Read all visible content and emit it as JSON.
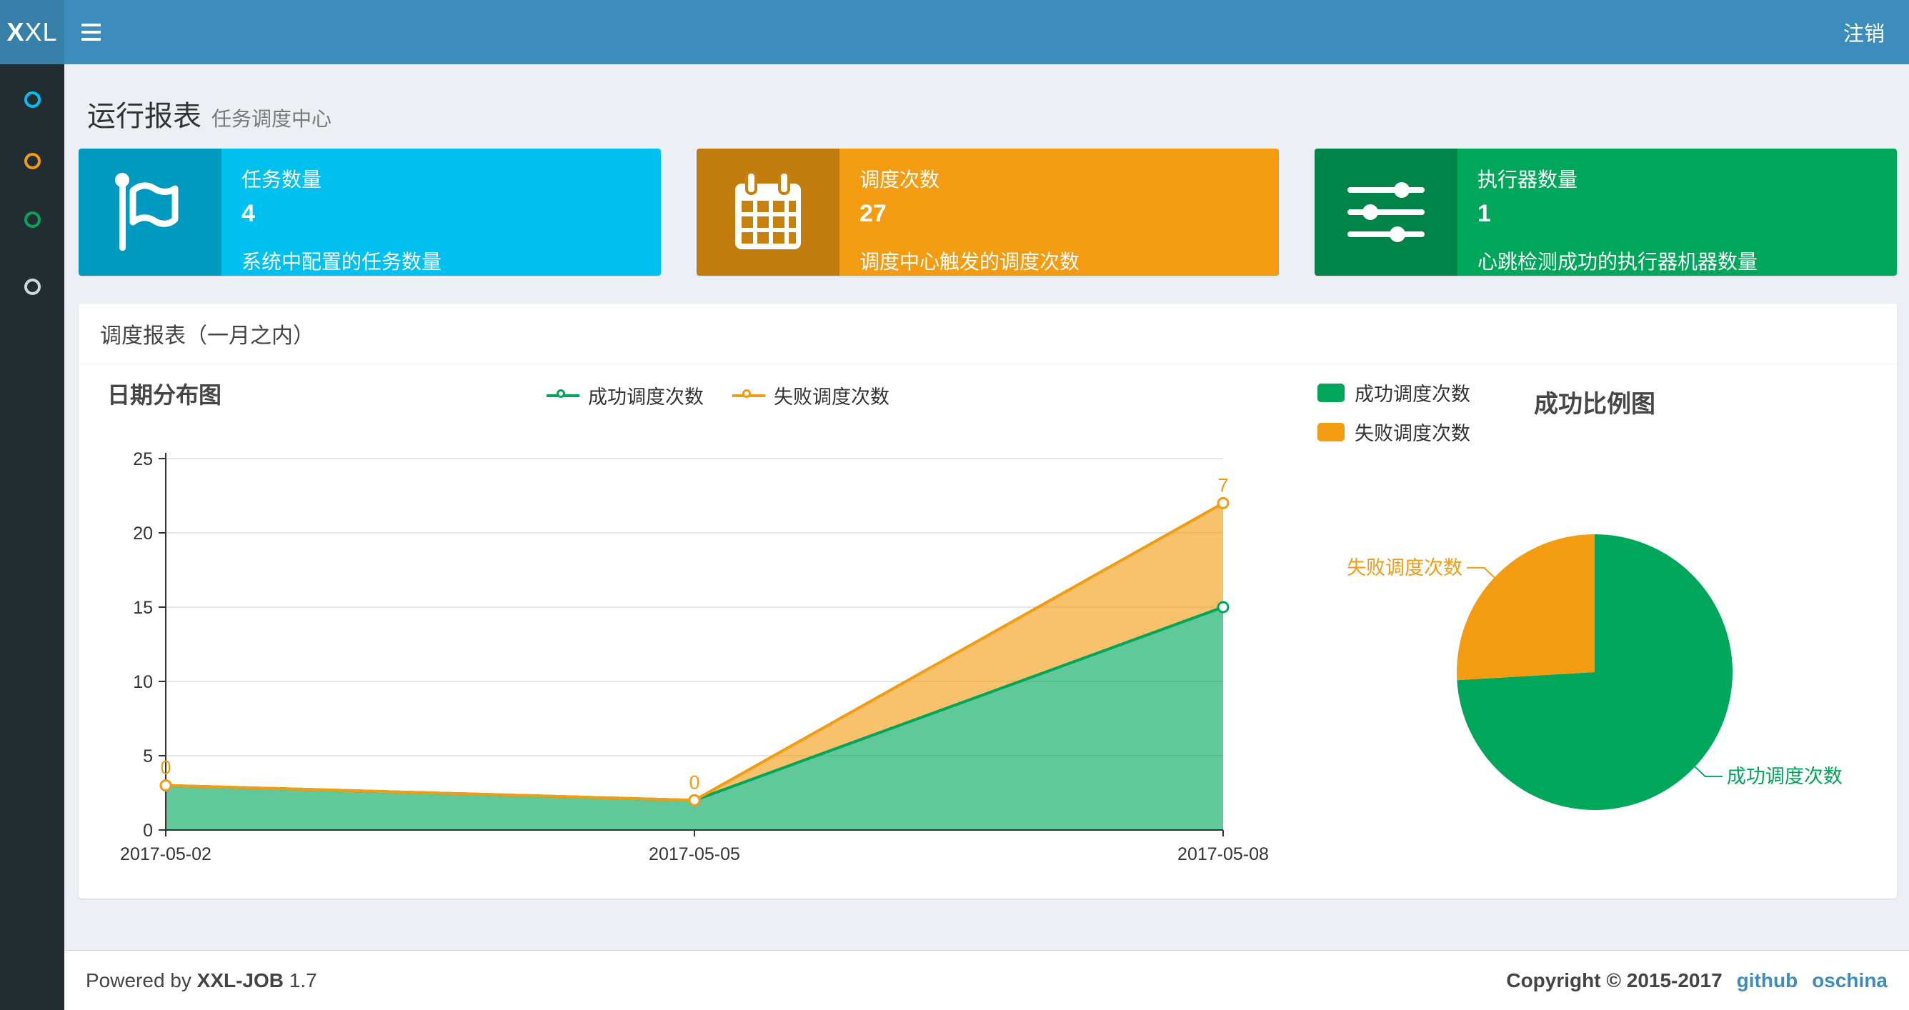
{
  "theme": {
    "navbar_bg": "#3c8dbc",
    "logo_bg": "#367fa9",
    "sidebar_bg": "#222d32",
    "page_bg": "#ecf0f5",
    "link_color": "#3c8dbc"
  },
  "navbar": {
    "logo": "XXL",
    "logout_label": "注销"
  },
  "sidebar": {
    "items": [
      {
        "icon": "circle-outline-icon",
        "color": "#00c0ef"
      },
      {
        "icon": "circle-outline-icon",
        "color": "#f39c12"
      },
      {
        "icon": "circle-outline-icon",
        "color": "#00a65a"
      },
      {
        "icon": "circle-outline-icon",
        "color": "#d2d6de"
      }
    ]
  },
  "page_header": {
    "title": "运行报表",
    "subtitle": "任务调度中心"
  },
  "info_boxes": [
    {
      "title": "任务数量",
      "value": "4",
      "description": "系统中配置的任务数量",
      "color": "#00c0ef",
      "icon": "flag-icon"
    },
    {
      "title": "调度次数",
      "value": "27",
      "description": "调度中心触发的调度次数",
      "color": "#f39c12",
      "icon": "calendar-icon"
    },
    {
      "title": "执行器数量",
      "value": "1",
      "description": "心跳检测成功的执行器机器数量",
      "color": "#00a65a",
      "icon": "sliders-icon"
    }
  ],
  "panel": {
    "title": "调度报表（一月之内）"
  },
  "chart_data": [
    {
      "type": "area",
      "title": "日期分布图",
      "categories": [
        "2017-05-02",
        "2017-05-05",
        "2017-05-08"
      ],
      "stacked": true,
      "series": [
        {
          "name": "成功调度次数",
          "values": [
            3,
            2,
            15
          ],
          "color": "#00a65a",
          "labels_shown": false
        },
        {
          "name": "失败调度次数",
          "values": [
            0,
            0,
            7
          ],
          "color": "#f39c12",
          "labels_shown": true
        }
      ],
      "ylim": [
        0,
        25
      ],
      "y_interval": 5,
      "xlabel": "",
      "ylabel": "",
      "grid": "horizontal-only",
      "legend_position": "top-center"
    },
    {
      "type": "pie",
      "title": "成功比例图",
      "slices": [
        {
          "name": "成功调度次数",
          "value": 20,
          "color": "#00a65a"
        },
        {
          "name": "失败调度次数",
          "value": 7,
          "color": "#f39c12"
        }
      ],
      "legend_position": "top-left"
    }
  ],
  "footer": {
    "powered_prefix": "Powered by",
    "product": "XXL-JOB",
    "version": "1.7",
    "copyright": "Copyright © 2015-2017",
    "links": [
      {
        "label": "github"
      },
      {
        "label": "oschina"
      }
    ]
  }
}
